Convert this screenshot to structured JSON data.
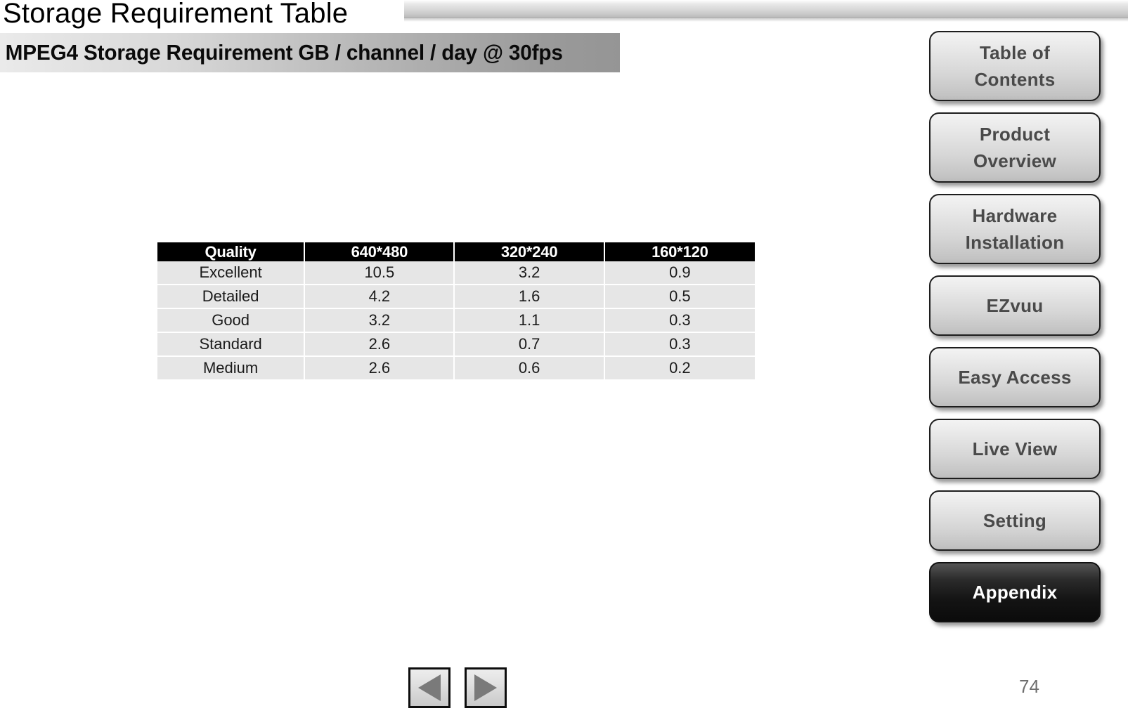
{
  "slide": {
    "title": "Storage Requirement Table",
    "subtitle": "MPEG4 Storage Requirement GB / channel / day @ 30fps",
    "page_number": "74"
  },
  "table": {
    "headers": [
      "Quality",
      "640*480",
      "320*240",
      "160*120"
    ],
    "rows": [
      [
        "Excellent",
        "10.5",
        "3.2",
        "0.9"
      ],
      [
        "Detailed",
        "4.2",
        "1.6",
        "0.5"
      ],
      [
        "Good",
        "3.2",
        "1.1",
        "0.3"
      ],
      [
        "Standard",
        "2.6",
        "0.7",
        "0.3"
      ],
      [
        "Medium",
        "2.6",
        "0.6",
        "0.2"
      ]
    ]
  },
  "side_nav": {
    "items": [
      {
        "label": "Table of\nContents",
        "lines": 2,
        "active": false
      },
      {
        "label": "Product\nOverview",
        "lines": 2,
        "active": false
      },
      {
        "label": "Hardware\nInstallation",
        "lines": 2,
        "active": false
      },
      {
        "label": "EZvuu",
        "lines": 1,
        "active": false
      },
      {
        "label": "Easy Access",
        "lines": 1,
        "active": false
      },
      {
        "label": "Live View",
        "lines": 1,
        "active": false
      },
      {
        "label": "Setting",
        "lines": 1,
        "active": false
      },
      {
        "label": "Appendix",
        "lines": 1,
        "active": true
      }
    ]
  },
  "nav_arrows": {
    "previous_label": "◀",
    "next_label": "▶"
  },
  "colors": {
    "header_row": "#000000",
    "body_row": "#e6e6e6",
    "active_button": "#141414",
    "button_text": "#4a4a4a"
  }
}
